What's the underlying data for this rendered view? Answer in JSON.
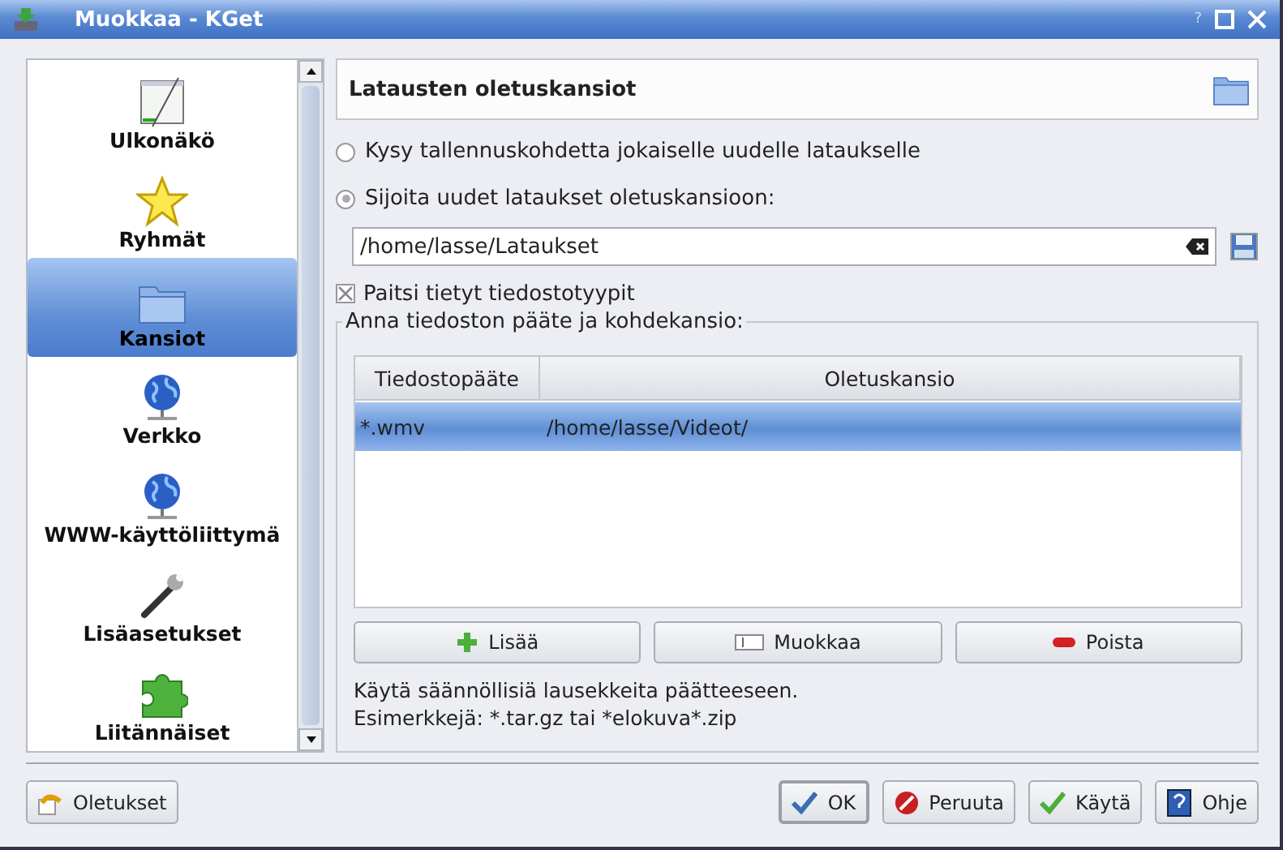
{
  "window": {
    "title": "Muokkaa - KGet",
    "controls": [
      "?"
    ]
  },
  "sidebar": {
    "items": [
      {
        "label": "Ulkonäkö",
        "kind": "appearance",
        "selected": false
      },
      {
        "label": "Ryhmät",
        "kind": "groups",
        "selected": false
      },
      {
        "label": "Kansiot",
        "kind": "folders",
        "selected": true
      },
      {
        "label": "Verkko",
        "kind": "network",
        "selected": false
      },
      {
        "label": "WWW-käyttöliittymä",
        "kind": "network",
        "selected": false
      },
      {
        "label": "Lisäasetukset",
        "kind": "advanced",
        "selected": false
      },
      {
        "label": "Liitännäiset",
        "kind": "plugins",
        "selected": false
      }
    ]
  },
  "header": {
    "title": "Latausten oletuskansiot"
  },
  "options": [
    {
      "label": "Kysy tallennuskohdetta jokaiselle uudelle lataukselle",
      "selected": false
    },
    {
      "label": "Sijoita uudet lataukset oletuskansioon:",
      "selected": true
    }
  ],
  "folder_field": {
    "value": "/home/lasse/Lataukset"
  },
  "except": {
    "label": "Paitsi tietyt tiedostotyypit",
    "checked": true
  },
  "group": {
    "legend": "Anna tiedoston pääte ja kohdekansio:",
    "table": {
      "columns": [
        "Tiedostopääte",
        "Oletuskansio"
      ],
      "rows": [
        {
          "cells": [
            "*.wmv",
            "/home/lasse/Videot/"
          ],
          "selected": true
        }
      ]
    },
    "buttons": [
      {
        "label": "Lisää",
        "kind": "add"
      },
      {
        "label": "Muokkaa",
        "kind": "edit"
      },
      {
        "label": "Poista",
        "kind": "remove"
      }
    ],
    "hint": [
      "Käytä säännöllisiä lausekkeita päätteeseen.",
      "Esimerkkejä: *.tar.gz tai *elokuva*.zip"
    ]
  },
  "footer": {
    "left": [
      {
        "label": "Oletukset",
        "kind": "defaults"
      }
    ],
    "right": [
      {
        "label": "OK",
        "kind": "ok"
      },
      {
        "label": "Peruuta",
        "kind": "cancel"
      },
      {
        "label": "Käytä",
        "kind": "apply"
      },
      {
        "label": "Ohje",
        "kind": "help"
      }
    ]
  }
}
